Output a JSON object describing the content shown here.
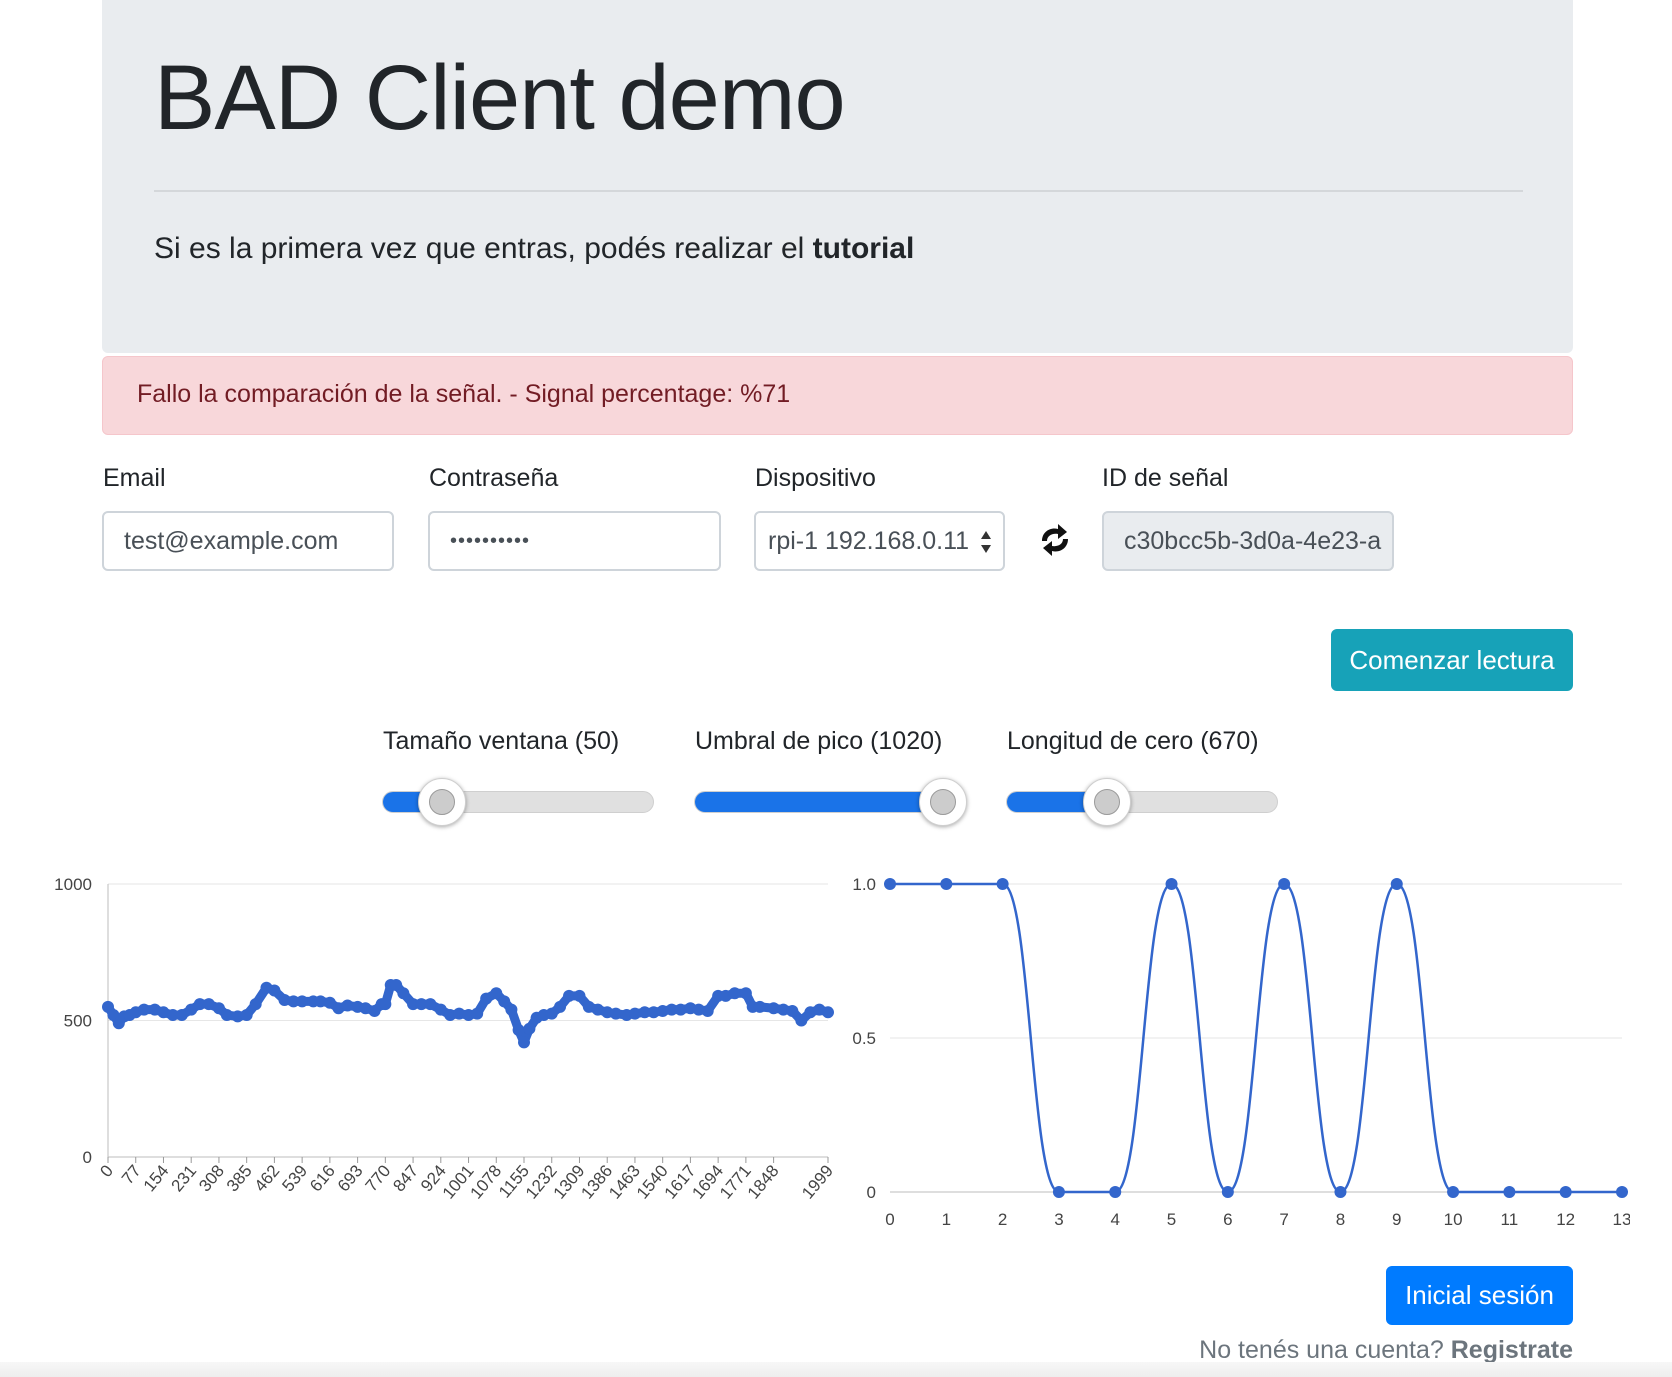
{
  "header": {
    "title": "BAD Client demo",
    "lead_text": "Si es la primera vez que entras, podés realizar el ",
    "lead_link": "tutorial"
  },
  "alert": {
    "message": "Fallo la comparación de la señal. - Signal percentage: %71",
    "color": "#f8d7da"
  },
  "form": {
    "email_label": "Email",
    "email_value": "test@example.com",
    "password_label": "Contraseña",
    "password_value": "••••••••••",
    "device_label": "Dispositivo",
    "device_value": "rpi-1 192.168.0.11",
    "signal_id_label": "ID de señal",
    "signal_id_value": "c30bcc5b-3d0a-4e23-a"
  },
  "buttons": {
    "start_reading": "Comenzar lectura",
    "login": "Inicial sesión"
  },
  "sliders": [
    {
      "label": "Tamaño ventana (50)",
      "fraction": 0.22
    },
    {
      "label": "Umbral de pico (1020)",
      "fraction": 0.92
    },
    {
      "label": "Longitud de cero (670)",
      "fraction": 0.37
    }
  ],
  "footer": {
    "question": "No tenés una cuenta? ",
    "register_link": "Registrate"
  },
  "colors": {
    "info": "#17a2b8",
    "primary": "#007bff",
    "series": "#3366cc"
  },
  "chart_data": [
    {
      "type": "line",
      "title": "",
      "xlabel": "",
      "ylabel": "",
      "ylim": [
        0,
        1000
      ],
      "yticks": [
        "0",
        "500",
        "1000"
      ],
      "xticks": [
        "0",
        "77",
        "154",
        "231",
        "308",
        "385",
        "462",
        "539",
        "616",
        "693",
        "770",
        "847",
        "924",
        "1001",
        "1078",
        "1155",
        "1232",
        "1309",
        "1386",
        "1463",
        "1540",
        "1617",
        "1694",
        "1771",
        "1848",
        "1999"
      ],
      "x": [
        0,
        15,
        30,
        45,
        60,
        77,
        100,
        130,
        154,
        180,
        205,
        231,
        255,
        280,
        308,
        330,
        360,
        385,
        410,
        440,
        462,
        490,
        515,
        539,
        570,
        590,
        616,
        640,
        665,
        693,
        715,
        740,
        760,
        770,
        785,
        800,
        820,
        847,
        870,
        895,
        924,
        950,
        975,
        1001,
        1025,
        1050,
        1078,
        1100,
        1120,
        1140,
        1155,
        1170,
        1190,
        1210,
        1232,
        1255,
        1280,
        1309,
        1335,
        1360,
        1386,
        1410,
        1440,
        1463,
        1490,
        1515,
        1540,
        1565,
        1590,
        1617,
        1640,
        1665,
        1694,
        1715,
        1740,
        1771,
        1790,
        1810,
        1848,
        1875,
        1900,
        1925,
        1950,
        1975,
        1999
      ],
      "values": [
        550,
        520,
        490,
        515,
        520,
        530,
        540,
        540,
        530,
        520,
        520,
        540,
        560,
        560,
        545,
        520,
        515,
        520,
        560,
        620,
        610,
        575,
        570,
        570,
        570,
        570,
        565,
        545,
        555,
        550,
        545,
        535,
        560,
        560,
        630,
        630,
        600,
        560,
        560,
        560,
        540,
        520,
        525,
        520,
        525,
        580,
        600,
        570,
        540,
        465,
        420,
        470,
        510,
        520,
        525,
        550,
        590,
        590,
        550,
        540,
        530,
        525,
        520,
        525,
        530,
        530,
        535,
        540,
        540,
        545,
        540,
        535,
        590,
        590,
        600,
        600,
        550,
        550,
        545,
        540,
        535,
        500,
        530,
        540,
        530
      ],
      "grid": true
    },
    {
      "type": "line",
      "title": "",
      "xlabel": "",
      "ylabel": "",
      "ylim": [
        0,
        1
      ],
      "yticks": [
        "0",
        "0.5",
        "1.0"
      ],
      "x": [
        0,
        1,
        2,
        3,
        4,
        5,
        6,
        7,
        8,
        9,
        10,
        11,
        12,
        13
      ],
      "values": [
        1,
        1,
        1,
        0,
        0,
        1,
        0,
        1,
        0,
        1,
        0,
        0,
        0,
        0
      ],
      "grid": true
    }
  ]
}
